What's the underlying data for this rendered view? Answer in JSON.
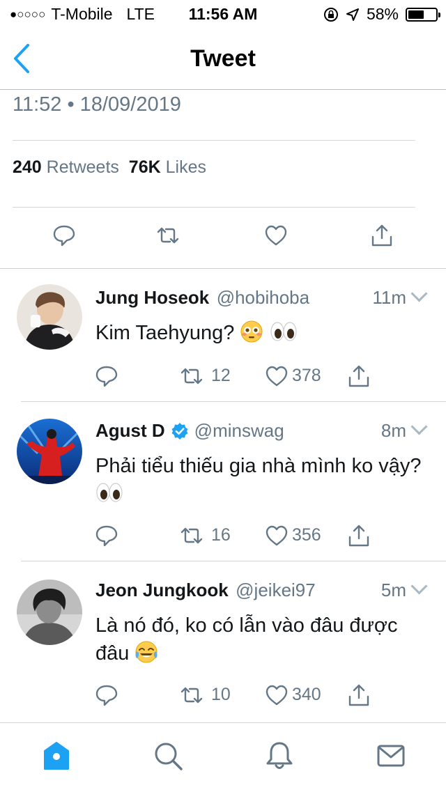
{
  "status_bar": {
    "signal": "●○○○○",
    "carrier": "T-Mobile",
    "network": "LTE",
    "time": "11:56 AM",
    "battery": "58%",
    "battery_level": 0.58
  },
  "nav": {
    "title": "Tweet"
  },
  "tweet": {
    "timestamp": "11:52 • 18/09/2019",
    "retweets_count": "240",
    "retweets_label": "Retweets",
    "likes_count": "76K",
    "likes_label": "Likes"
  },
  "replies": [
    {
      "name": "Jung Hoseok",
      "handle": "@hobihoba",
      "time": "11m",
      "text": "Kim Taehyung?",
      "emoji": [
        "flushed-face",
        "eyes"
      ],
      "retweets": "12",
      "likes": "378",
      "verified": false
    },
    {
      "name": "Agust D",
      "handle": "@minswag",
      "time": "8m",
      "text": "Phải tiểu thiếu gia nhà mình ko vậy?",
      "emoji": [
        "eyes"
      ],
      "retweets": "16",
      "likes": "356",
      "verified": true
    },
    {
      "name": "Jeon Jungkook",
      "handle": "@jeikei97",
      "time": "5m",
      "text": "Là nó đó, ko có lẫn vào đâu được đâu",
      "emoji": [
        "tears-of-joy"
      ],
      "retweets": "10",
      "likes": "340",
      "verified": false
    }
  ],
  "tabbar": {
    "items": [
      "home-icon",
      "search-icon",
      "notifications-icon",
      "messages-icon"
    ]
  },
  "colors": {
    "accent": "#1da1f2",
    "secondary_text": "#657786",
    "primary_text": "#14171a"
  }
}
